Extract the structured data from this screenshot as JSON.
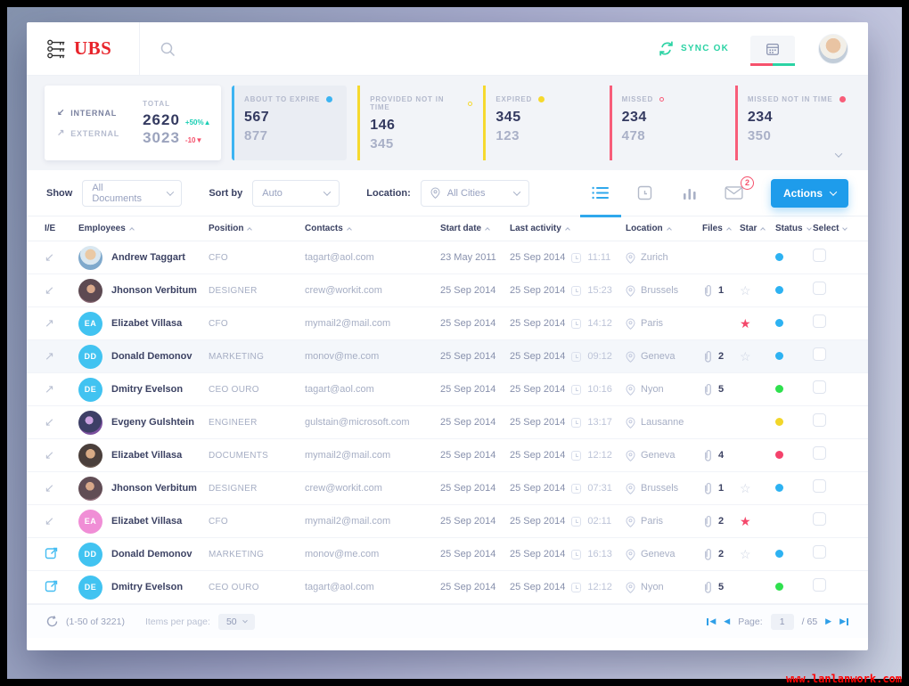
{
  "watermark": "www.lanlanwork.com",
  "colors": {
    "brand_red": "#e8242b",
    "accent_blue": "#1e9ceb",
    "sync_green": "#2bd3a4",
    "status_blue": "#2db2f2",
    "status_green": "#2fe04e",
    "status_yellow": "#f2d629",
    "status_red": "#f4426b"
  },
  "icons": {
    "ie_internal": "↙",
    "ie_external": "↗",
    "star_filled": "★",
    "star_outline": "☆",
    "delta_up": "▲",
    "delta_down": "▼",
    "pager_prev": "◀",
    "pager_next": "▶"
  },
  "header": {
    "logo_text": "UBS",
    "sync_label": "SYNC OK"
  },
  "stats": {
    "internal_label": "INTERNAL",
    "external_label": "EXTERNAL",
    "total_label": "TOTAL",
    "total_internal": "2620",
    "total_internal_delta": "+50%",
    "total_external": "3023",
    "total_external_delta": "-10",
    "blocks": [
      {
        "label": "ABOUT TO EXPIRE",
        "primary": "567",
        "secondary": "877",
        "accent": "#3cb4f2",
        "dot": "filled"
      },
      {
        "label": "PROVIDED NOT IN TIME",
        "primary": "146",
        "secondary": "345",
        "accent": "#f6d92e",
        "dot": "ring"
      },
      {
        "label": "EXPIRED",
        "primary": "345",
        "secondary": "123",
        "accent": "#f6d92e",
        "dot": "filled"
      },
      {
        "label": "MISSED",
        "primary": "234",
        "secondary": "478",
        "accent": "#f85d79",
        "dot": "ring"
      },
      {
        "label": "MISSED NOT IN TIME",
        "primary": "234",
        "secondary": "350",
        "accent": "#f85d79",
        "dot": "filled"
      }
    ]
  },
  "filters": {
    "show_label": "Show",
    "show_value": "All Documents",
    "sort_label": "Sort by",
    "sort_value": "Auto",
    "location_label": "Location:",
    "location_value": "All Cities",
    "mail_badge": "2",
    "actions_label": "Actions"
  },
  "table": {
    "columns": [
      {
        "label": "I/E",
        "caret": "none"
      },
      {
        "label": "Employees",
        "caret": "up"
      },
      {
        "label": "Position",
        "caret": "up"
      },
      {
        "label": "Contacts",
        "caret": "up"
      },
      {
        "label": "Start date",
        "caret": "up"
      },
      {
        "label": "Last activity",
        "caret": "up"
      },
      {
        "label": "Location",
        "caret": "up"
      },
      {
        "label": "Files",
        "caret": "up"
      },
      {
        "label": "Star",
        "caret": "up"
      },
      {
        "label": "Status",
        "caret": "down"
      },
      {
        "label": "Select",
        "caret": "down"
      }
    ],
    "rows": [
      {
        "ie": "internal",
        "avatar": {
          "type": "photo",
          "variant": "p1"
        },
        "name": "Andrew Taggart",
        "position": "CFO",
        "contact": "tagart@aol.com",
        "start_date": "23 May 2011",
        "activity_date": "25 Sep 2014",
        "activity_time": "11:11",
        "location": "Zurich",
        "files": "",
        "star": "none",
        "status": "blue",
        "highlight": false
      },
      {
        "ie": "internal",
        "avatar": {
          "type": "photo",
          "variant": "p2"
        },
        "name": "Jhonson Verbitum",
        "position": "DESIGNER",
        "contact": "crew@workit.com",
        "start_date": "25 Sep 2014",
        "activity_date": "25 Sep 2014",
        "activity_time": "15:23",
        "location": "Brussels",
        "files": "1",
        "star": "outline",
        "status": "blue",
        "highlight": false
      },
      {
        "ie": "external",
        "avatar": {
          "type": "initials",
          "initials": "EA",
          "color": "#41c3f1"
        },
        "name": "Elizabet Villasa",
        "position": "CFO",
        "contact": "mymail2@mail.com",
        "start_date": "25 Sep 2014",
        "activity_date": "25 Sep 2014",
        "activity_time": "14:12",
        "location": "Paris",
        "files": "",
        "star": "filled",
        "status": "blue",
        "highlight": false
      },
      {
        "ie": "external",
        "avatar": {
          "type": "initials",
          "initials": "DD",
          "color": "#41c3f1"
        },
        "name": "Donald Demonov",
        "position": "MARKETING",
        "contact": "monov@me.com",
        "start_date": "25 Sep 2014",
        "activity_date": "25 Sep 2014",
        "activity_time": "09:12",
        "location": "Geneva",
        "files": "2",
        "star": "outline",
        "status": "blue",
        "highlight": true
      },
      {
        "ie": "external",
        "avatar": {
          "type": "initials",
          "initials": "DE",
          "color": "#41c3f1"
        },
        "name": "Dmitry Evelson",
        "position": "CEO OURO",
        "contact": "tagart@aol.com",
        "start_date": "25 Sep 2014",
        "activity_date": "25 Sep 2014",
        "activity_time": "10:16",
        "location": "Nyon",
        "files": "5",
        "star": "none",
        "status": "green",
        "highlight": false
      },
      {
        "ie": "internal",
        "avatar": {
          "type": "photo",
          "variant": "p3"
        },
        "name": "Evgeny Gulshtein",
        "position": "ENGINEER",
        "contact": "gulstain@microsoft.com",
        "start_date": "25 Sep 2014",
        "activity_date": "25 Sep 2014",
        "activity_time": "13:17",
        "location": "Lausanne",
        "files": "",
        "star": "none",
        "status": "yellow",
        "highlight": false
      },
      {
        "ie": "internal",
        "avatar": {
          "type": "photo",
          "variant": "p4"
        },
        "name": "Elizabet Villasa",
        "position": "DOCUMENTS",
        "contact": "mymail2@mail.com",
        "start_date": "25 Sep 2014",
        "activity_date": "25 Sep 2014",
        "activity_time": "12:12",
        "location": "Geneva",
        "files": "4",
        "star": "none",
        "status": "red",
        "highlight": false
      },
      {
        "ie": "internal",
        "avatar": {
          "type": "photo",
          "variant": "p5"
        },
        "name": "Jhonson Verbitum",
        "position": "DESIGNER",
        "contact": "crew@workit.com",
        "start_date": "25 Sep 2014",
        "activity_date": "25 Sep 2014",
        "activity_time": "07:31",
        "location": "Brussels",
        "files": "1",
        "star": "outline",
        "status": "blue",
        "highlight": false
      },
      {
        "ie": "internal",
        "avatar": {
          "type": "initials",
          "initials": "EA",
          "color": "#f08ed6"
        },
        "name": "Elizabet Villasa",
        "position": "CFO",
        "contact": "mymail2@mail.com",
        "start_date": "25 Sep 2014",
        "activity_date": "25 Sep 2014",
        "activity_time": "02:11",
        "location": "Paris",
        "files": "2",
        "star": "filled",
        "status": "none",
        "highlight": false
      },
      {
        "ie": "external-link",
        "avatar": {
          "type": "initials",
          "initials": "DD",
          "color": "#41c3f1"
        },
        "name": "Donald Demonov",
        "position": "MARKETING",
        "contact": "monov@me.com",
        "start_date": "25 Sep 2014",
        "activity_date": "25 Sep 2014",
        "activity_time": "16:13",
        "location": "Geneva",
        "files": "2",
        "star": "outline",
        "status": "blue",
        "highlight": false
      },
      {
        "ie": "external-link",
        "avatar": {
          "type": "initials",
          "initials": "DE",
          "color": "#41c3f1"
        },
        "name": "Dmitry Evelson",
        "position": "CEO OURO",
        "contact": "tagart@aol.com",
        "start_date": "25 Sep 2014",
        "activity_date": "25 Sep 2014",
        "activity_time": "12:12",
        "location": "Nyon",
        "files": "5",
        "star": "none",
        "status": "green",
        "highlight": false
      }
    ]
  },
  "footer": {
    "range": "(1-50 of 3221)",
    "items_per_page_label": "Items per page:",
    "items_per_page": "50",
    "page_label": "Page:",
    "page": "1",
    "total": "/ 65"
  }
}
